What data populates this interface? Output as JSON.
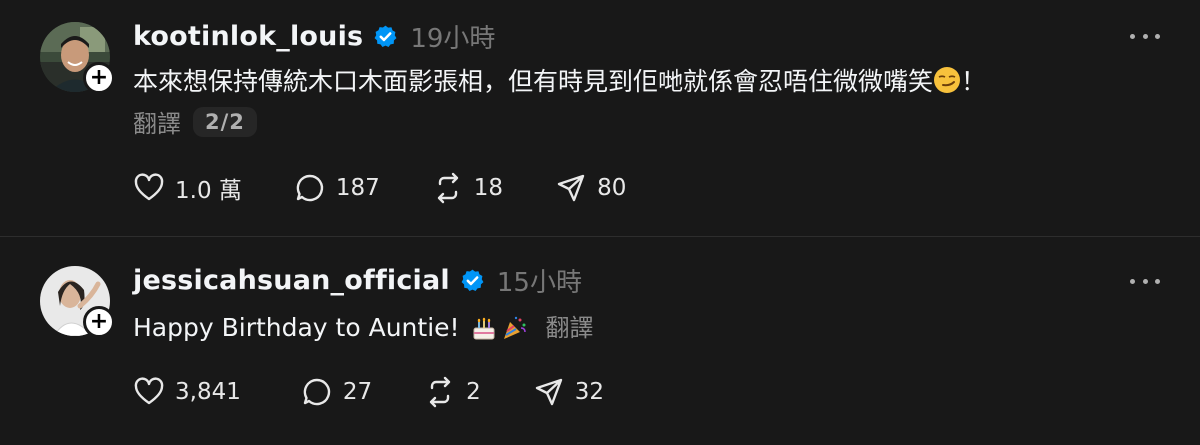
{
  "posts": [
    {
      "username": "kootinlok_louis",
      "time": "19小時",
      "text": "本來想保持傳統木口木面影張相，但有時見到佢哋就係會忍唔住微微嘴笑",
      "text_end": "！",
      "emoji": "smirk-emoji",
      "translate_label": "翻譯",
      "page_indicator": "2/2",
      "likes": "1.0 萬",
      "replies": "187",
      "reposts": "18",
      "shares": "80"
    },
    {
      "username": "jessicahsuan_official",
      "time": "15小時",
      "text": "Happy Birthday to Auntie!",
      "emojis": [
        "birthday-cake-emoji",
        "party-emoji"
      ],
      "translate_label": "翻譯",
      "likes": "3,841",
      "replies": "27",
      "reposts": "2",
      "shares": "32"
    }
  ],
  "colors": {
    "background": "#181818",
    "text": "#f3f5f7",
    "muted": "#777777",
    "verified": "#0095f6"
  }
}
